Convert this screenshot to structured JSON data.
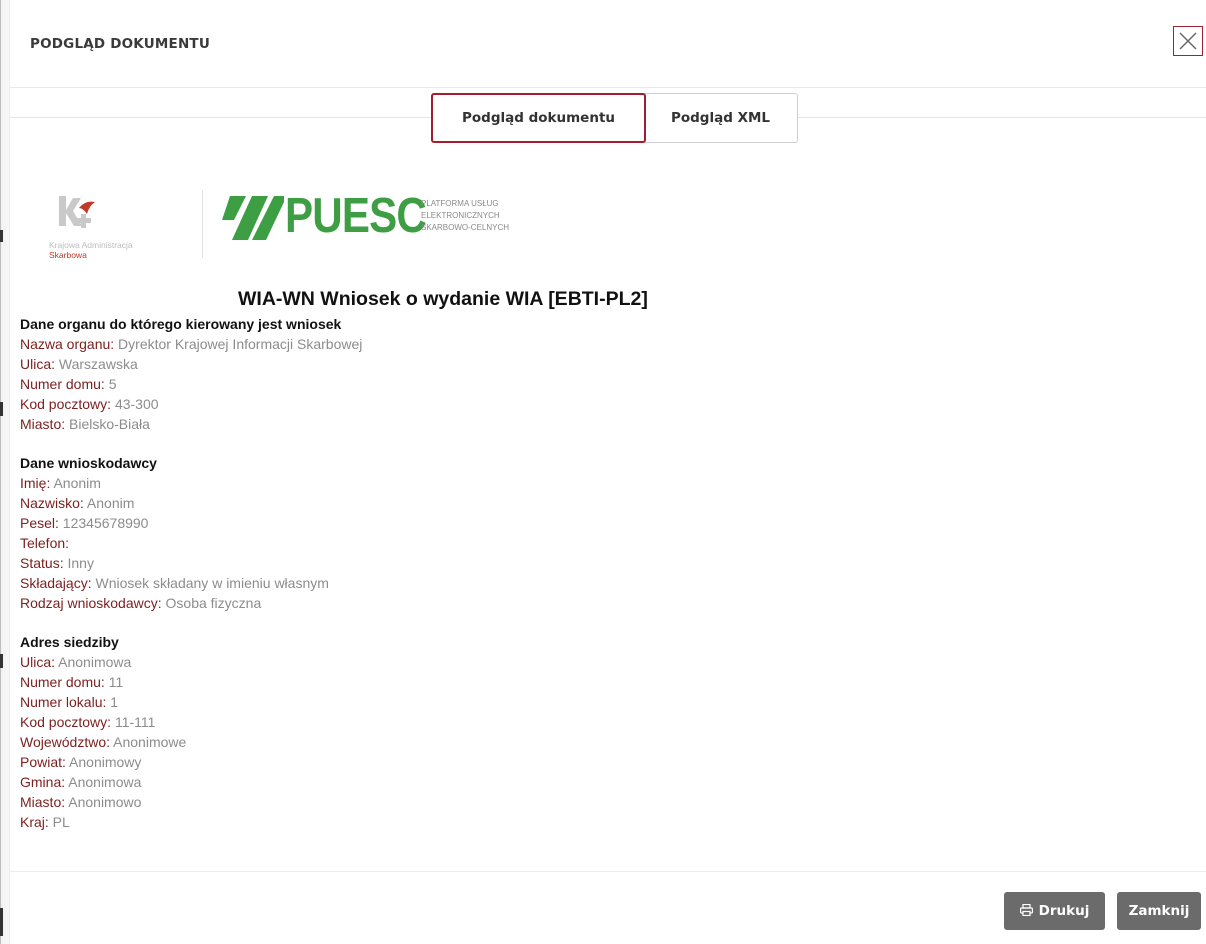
{
  "modal": {
    "title": "PODGLĄD DOKUMENTU",
    "close_icon": "close-icon"
  },
  "tabs": [
    {
      "label": "Podgląd dokumentu",
      "active": true
    },
    {
      "label": "Podgląd XML",
      "active": false
    }
  ],
  "logos": {
    "kas_line1": "Krajowa Administracja",
    "kas_line2": "Skarbowa",
    "puesc_name": "PUESC",
    "puesc_sub1": "PLATFORMA USŁUG",
    "puesc_sub2": "ELEKTRONICZNYCH",
    "puesc_sub3": "SKARBOWO-CELNYCH"
  },
  "document": {
    "title": "WIA-WN Wniosek o wydanie WIA [EBTI-PL2]",
    "sections": [
      {
        "heading": "Dane organu do którego kierowany jest wniosek",
        "fields": [
          {
            "label": "Nazwa organu:",
            "value": " Dyrektor Krajowej Informacji Skarbowej"
          },
          {
            "label": "Ulica:",
            "value": " Warszawska"
          },
          {
            "label": "Numer domu:",
            "value": " 5"
          },
          {
            "label": "Kod pocztowy:",
            "value": " 43-300"
          },
          {
            "label": "Miasto:",
            "value": " Bielsko-Biała"
          }
        ]
      },
      {
        "heading": "Dane wnioskodawcy",
        "fields": [
          {
            "label": "Imię:",
            "value": " Anonim"
          },
          {
            "label": "Nazwisko:",
            "value": " Anonim"
          },
          {
            "label": "Pesel:",
            "value": " 12345678990"
          },
          {
            "label": "Telefon:",
            "value": ""
          },
          {
            "label": "Status:",
            "value": " Inny"
          },
          {
            "label": "Składający:",
            "value": " Wniosek składany w imieniu własnym"
          },
          {
            "label": "Rodzaj wnioskodawcy:",
            "value": " Osoba fizyczna"
          }
        ]
      },
      {
        "heading": "Adres siedziby",
        "fields": [
          {
            "label": "Ulica:",
            "value": " Anonimowa"
          },
          {
            "label": "Numer domu:",
            "value": " 11"
          },
          {
            "label": "Numer lokalu:",
            "value": " 1"
          },
          {
            "label": "Kod pocztowy:",
            "value": " 11-111"
          },
          {
            "label": "Województwo:",
            "value": " Anonimowe"
          },
          {
            "label": "Powiat:",
            "value": " Anonimowy"
          },
          {
            "label": "Gmina:",
            "value": " Anonimowa"
          },
          {
            "label": "Miasto:",
            "value": " Anonimowo"
          },
          {
            "label": "Kraj:",
            "value": " PL"
          }
        ]
      }
    ]
  },
  "footer": {
    "print_label": "Drukuj",
    "print_icon": "printer-icon",
    "close_label": "Zamknij"
  },
  "colors": {
    "accent": "#a31d2e",
    "label": "#7b1f1f",
    "value": "#8c8c8c",
    "button": "#6b6b6b",
    "puesc_green": "#3e9e44"
  }
}
